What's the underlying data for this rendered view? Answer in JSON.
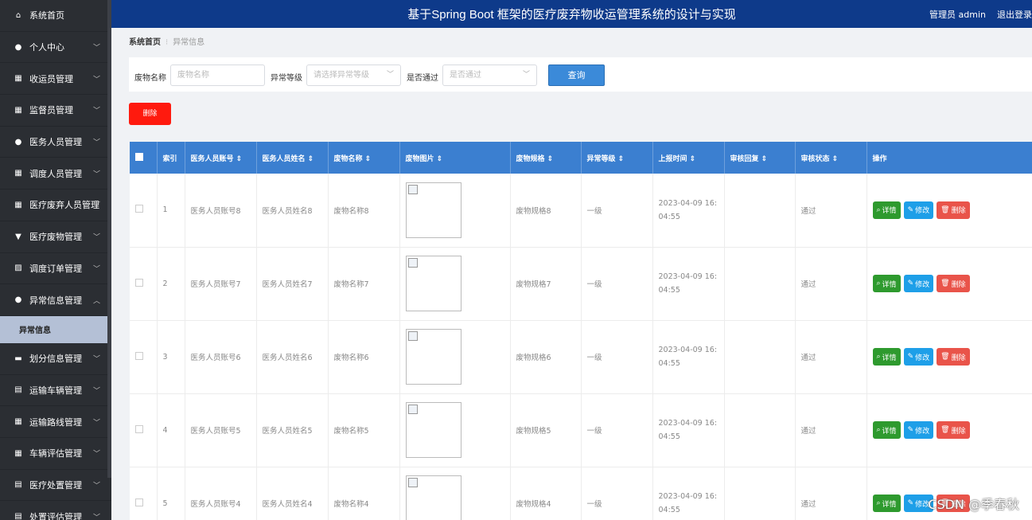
{
  "header": {
    "title": "基于Spring Boot 框架的医疗废弃物收运管理系统的设计与实现",
    "user": "管理员 admin",
    "logout": "退出登录"
  },
  "sidebar": {
    "items": [
      {
        "label": "系统首页",
        "icon": "home-icon"
      },
      {
        "label": "个人中心",
        "icon": "person-icon"
      },
      {
        "label": "收运员管理",
        "icon": "grid-icon"
      },
      {
        "label": "监督员管理",
        "icon": "grid-icon"
      },
      {
        "label": "医务人员管理",
        "icon": "person-icon"
      },
      {
        "label": "调度人员管理",
        "icon": "grid-icon"
      },
      {
        "label": "医疗废弃人员管理",
        "icon": "grid-icon"
      },
      {
        "label": "医疗废物管理",
        "icon": "tag-icon"
      },
      {
        "label": "调度订单管理",
        "icon": "chart-icon"
      },
      {
        "label": "异常信息管理",
        "icon": "person-icon"
      },
      {
        "label": "划分信息管理",
        "icon": "briefcase-icon"
      },
      {
        "label": "运输车辆管理",
        "icon": "clipboard-icon"
      },
      {
        "label": "运输路线管理",
        "icon": "table-icon"
      },
      {
        "label": "车辆评估管理",
        "icon": "grid-icon"
      },
      {
        "label": "医疗处置管理",
        "icon": "clipboard-icon"
      },
      {
        "label": "处置评估管理",
        "icon": "clipboard-icon"
      }
    ],
    "active_sub": "异常信息"
  },
  "breadcrumb": {
    "home": "系统首页",
    "current": "异常信息"
  },
  "filter": {
    "name_label": "废物名称",
    "name_placeholder": "废物名称",
    "level_label": "异常等级",
    "level_placeholder": "请选择异常等级",
    "pass_label": "是否通过",
    "pass_placeholder": "是否通过",
    "query_label": "查询"
  },
  "delete_label": "删除",
  "table": {
    "headers": [
      "索引",
      "医务人员账号 ⇕",
      "医务人员姓名 ⇕",
      "废物名称 ⇕",
      "废物图片 ⇕",
      "废物规格 ⇕",
      "异常等级 ⇕",
      "上报时间 ⇕",
      "审核回复 ⇕",
      "审核状态 ⇕",
      "操作"
    ],
    "rows": [
      {
        "index": "1",
        "account": "医务人员账号8",
        "name": "医务人员姓名8",
        "waste": "废物名称8",
        "spec": "废物规格8",
        "level": "一级",
        "time1": "2023-04-09 16:",
        "time2": "04:55",
        "reply": "",
        "status": "通过"
      },
      {
        "index": "2",
        "account": "医务人员账号7",
        "name": "医务人员姓名7",
        "waste": "废物名称7",
        "spec": "废物规格7",
        "level": "一级",
        "time1": "2023-04-09 16:",
        "time2": "04:55",
        "reply": "",
        "status": "通过"
      },
      {
        "index": "3",
        "account": "医务人员账号6",
        "name": "医务人员姓名6",
        "waste": "废物名称6",
        "spec": "废物规格6",
        "level": "一级",
        "time1": "2023-04-09 16:",
        "time2": "04:55",
        "reply": "",
        "status": "通过"
      },
      {
        "index": "4",
        "account": "医务人员账号5",
        "name": "医务人员姓名5",
        "waste": "废物名称5",
        "spec": "废物规格5",
        "level": "一级",
        "time1": "2023-04-09 16:",
        "time2": "04:55",
        "reply": "",
        "status": "通过"
      },
      {
        "index": "5",
        "account": "医务人员账号4",
        "name": "医务人员姓名4",
        "waste": "废物名称4",
        "spec": "废物规格4",
        "level": "一级",
        "time1": "2023-04-09 16:",
        "time2": "04:55",
        "reply": "",
        "status": "通过"
      }
    ],
    "ops": {
      "detail": "详情",
      "edit": "修改",
      "delete": "删除"
    }
  },
  "watermark": "CSDN @季春秋"
}
